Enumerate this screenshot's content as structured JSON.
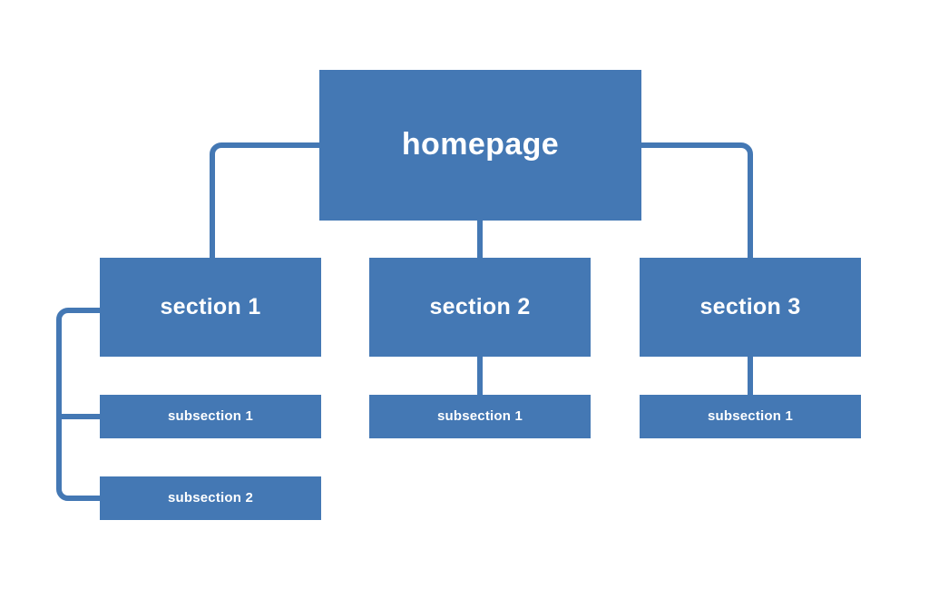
{
  "diagram": {
    "type": "sitemap-tree",
    "background_color": "#ffffff",
    "node_color": "#4478b4",
    "connector_color": "#4478b4",
    "text_color": "#ffffff",
    "nodes": {
      "root": {
        "label": "homepage"
      },
      "sections": [
        {
          "label": "section 1"
        },
        {
          "label": "section 2"
        },
        {
          "label": "section 3"
        }
      ],
      "subsections": [
        {
          "label": "subsection 1",
          "parent": "section 1"
        },
        {
          "label": "subsection 2",
          "parent": "section 1"
        },
        {
          "label": "subsection 1",
          "parent": "section 2"
        },
        {
          "label": "subsection 1",
          "parent": "section 3"
        }
      ]
    }
  }
}
